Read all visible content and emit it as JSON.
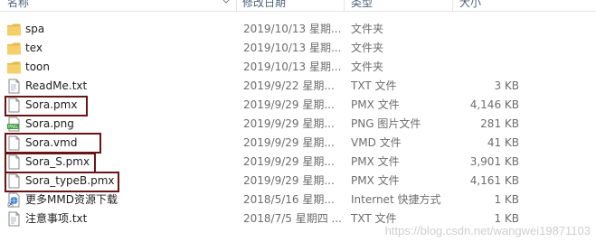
{
  "header": {
    "name": "名称",
    "date": "修改日期",
    "type": "类型",
    "size": "大小"
  },
  "files": [
    {
      "name": "spa",
      "date": "2019/10/13 星期...",
      "type": "文件夹",
      "size": "",
      "icon": "folder-icon"
    },
    {
      "name": "tex",
      "date": "2019/10/13 星期...",
      "type": "文件夹",
      "size": "",
      "icon": "folder-icon"
    },
    {
      "name": "toon",
      "date": "2019/10/13 星期...",
      "type": "文件夹",
      "size": "",
      "icon": "folder-icon"
    },
    {
      "name": "ReadMe.txt",
      "date": "2019/9/22 星期...",
      "type": "TXT 文件",
      "size": "3 KB",
      "icon": "text-file-icon"
    },
    {
      "name": "Sora.pmx",
      "date": "2019/9/29 星期...",
      "type": "PMX 文件",
      "size": "4,146 KB",
      "icon": "blank-file-icon"
    },
    {
      "name": "Sora.png",
      "date": "2019/9/29 星期...",
      "type": "PNG 图片文件",
      "size": "281 KB",
      "icon": "png-image-icon"
    },
    {
      "name": "Sora.vmd",
      "date": "2019/9/29 星期...",
      "type": "VMD 文件",
      "size": "41 KB",
      "icon": "blank-file-icon"
    },
    {
      "name": "Sora_S.pmx",
      "date": "2019/9/29 星期...",
      "type": "PMX 文件",
      "size": "3,901 KB",
      "icon": "blank-file-icon"
    },
    {
      "name": "Sora_typeB.pmx",
      "date": "2019/9/29 星期...",
      "type": "PMX 文件",
      "size": "4,161 KB",
      "icon": "blank-file-icon"
    },
    {
      "name": "更多MMD资源下载",
      "date": "2018/5/16 星期...",
      "type": "Internet 快捷方式",
      "size": "1 KB",
      "icon": "internet-shortcut-icon"
    },
    {
      "name": "注意事项.txt",
      "date": "2018/7/5 星期四 ...",
      "type": "TXT 文件",
      "size": "1 KB",
      "icon": "text-file-icon"
    }
  ],
  "watermark": "https://blog.csdn.net/wangwei19871103",
  "colors": {
    "highlight_border": "#6b1415",
    "folder": "#f0c35a",
    "header_text": "#4c607a"
  }
}
